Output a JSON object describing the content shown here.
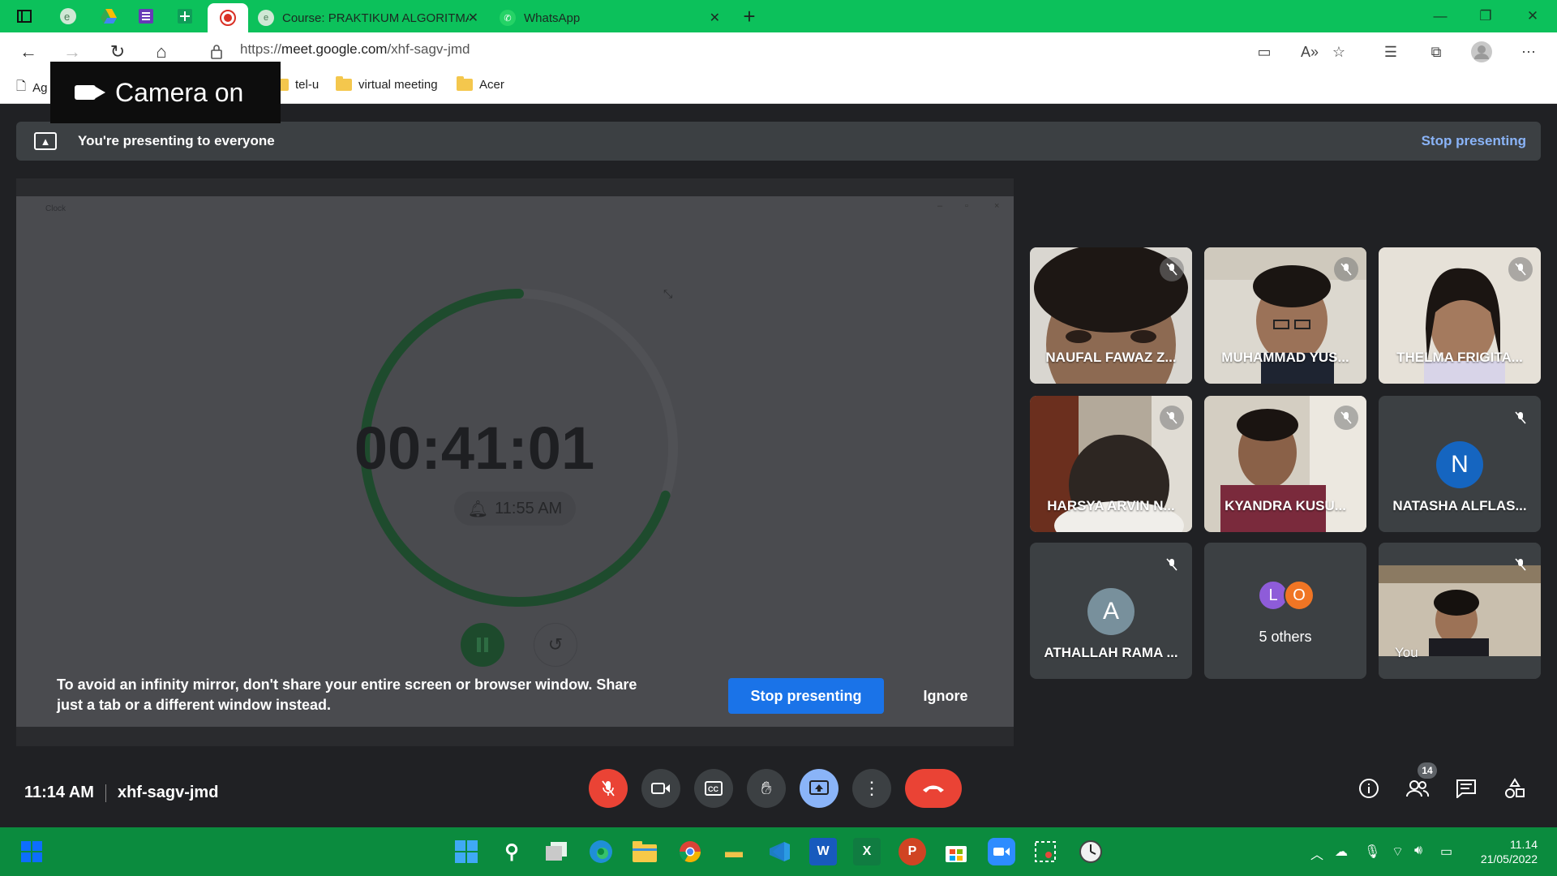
{
  "browser": {
    "tabs": [
      {
        "title": "Course: PRAKTIKUM ALGORITMA"
      },
      {
        "title": "WhatsApp"
      }
    ],
    "url_prefix": "https://",
    "url_host": "meet.google.com",
    "url_path": "/xhf-sagv-jmd",
    "bookmarks": [
      {
        "label": "tel-u"
      },
      {
        "label": "virtual meeting"
      },
      {
        "label": "Acer"
      }
    ],
    "bookmark_partial": "Ag",
    "camera_toast": "Camera on"
  },
  "meet": {
    "banner_text": "You're presenting to everyone",
    "banner_stop": "Stop presenting",
    "shared_window": {
      "title": "Clock",
      "timer": "00:41:01",
      "alarm": "11:55 AM",
      "progress": 0.7
    },
    "warning": {
      "text": "To avoid an infinity mirror, don't share your entire screen or browser window. Share just a tab or a different window instead.",
      "stop_label": "Stop presenting",
      "ignore_label": "Ignore"
    },
    "participants": [
      {
        "name": "NAUFAL FAWAZ Z..."
      },
      {
        "name": "MUHAMMAD YUS..."
      },
      {
        "name": "THELMA FRIGITA..."
      },
      {
        "name": "HARSYA ARVIN N..."
      },
      {
        "name": "KYANDRA KUSU..."
      },
      {
        "name": "NATASHA ALFLAS...",
        "initial": "N",
        "color": "#1565c0"
      },
      {
        "name": "ATHALLAH RAMA ...",
        "initial": "A",
        "color": "#78909c"
      },
      {
        "name": "You"
      }
    ],
    "others": {
      "label": "5 others",
      "initials": [
        "L",
        "O"
      ],
      "colors": [
        "#8e5cd9",
        "#f07524"
      ]
    },
    "time": "11:14 AM",
    "meeting_code": "xhf-sagv-jmd",
    "people_count": "14"
  },
  "taskbar": {
    "time": "11.14",
    "date": "21/05/2022"
  },
  "colors": {
    "tabbar": "#0cc15b",
    "taskbar": "#0b8b3e",
    "meet_bg": "#202124",
    "accent_blue": "#1a73e8",
    "end_red": "#ea4335"
  }
}
